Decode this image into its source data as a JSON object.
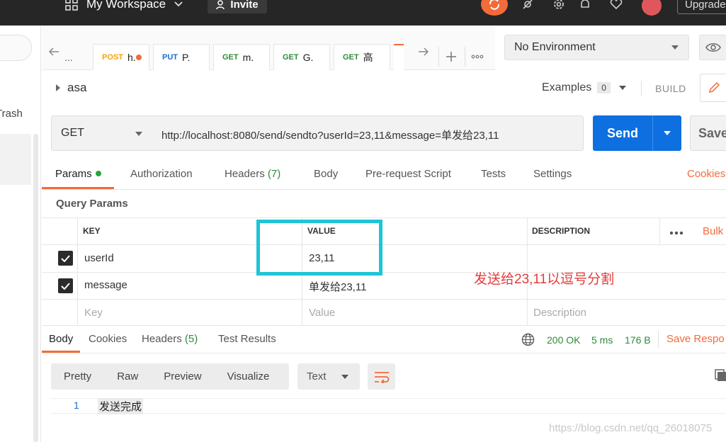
{
  "topbar": {
    "workspace": "My Workspace",
    "invite": "Invite",
    "upgrade": "Upgrade"
  },
  "sidebar": {
    "trash": "Trash"
  },
  "tabs": [
    {
      "method": "",
      "label": "..."
    },
    {
      "method": "POST",
      "label": "h."
    },
    {
      "method": "PUT",
      "label": "P."
    },
    {
      "method": "GET",
      "label": "m."
    },
    {
      "method": "GET",
      "label": "G."
    },
    {
      "method": "GET",
      "label": "高"
    }
  ],
  "environment": {
    "selected": "No Environment"
  },
  "request": {
    "name": "asa",
    "examples_label": "Examples",
    "examples_count": "0",
    "build_label": "BUILD",
    "method": "GET",
    "url": "http://localhost:8080/send/sendto?userId=23,11&message=单发给23,11",
    "send_label": "Send",
    "save_label": "Save"
  },
  "request_tabs": {
    "params": "Params",
    "authorization": "Authorization",
    "headers": "Headers",
    "headers_count": "(7)",
    "body": "Body",
    "prerequest": "Pre-request Script",
    "tests": "Tests",
    "settings": "Settings",
    "cookies": "Cookies"
  },
  "query_params": {
    "title": "Query Params",
    "columns": {
      "key": "KEY",
      "value": "VALUE",
      "description": "DESCRIPTION"
    },
    "bulk_edit": "Bulk",
    "rows": [
      {
        "key": "userId",
        "value": "23,11",
        "description": "",
        "checked": true
      },
      {
        "key": "message",
        "value": "单发给23,11",
        "description": "",
        "checked": true
      }
    ],
    "placeholder": {
      "key": "Key",
      "value": "Value",
      "description": "Description"
    }
  },
  "annotation": "发送给23,11以逗号分割",
  "response": {
    "tabs": {
      "body": "Body",
      "cookies": "Cookies",
      "headers": "Headers",
      "headers_count": "(5)",
      "test_results": "Test Results"
    },
    "status": "200 OK",
    "time": "5 ms",
    "size": "176 B",
    "save_response": "Save Respo",
    "formats": [
      "Pretty",
      "Raw",
      "Preview",
      "Visualize"
    ],
    "text_type": "Text",
    "line_number": "1",
    "body_text": "发送完成"
  },
  "watermark": "https://blog.csdn.net/qq_26018075"
}
